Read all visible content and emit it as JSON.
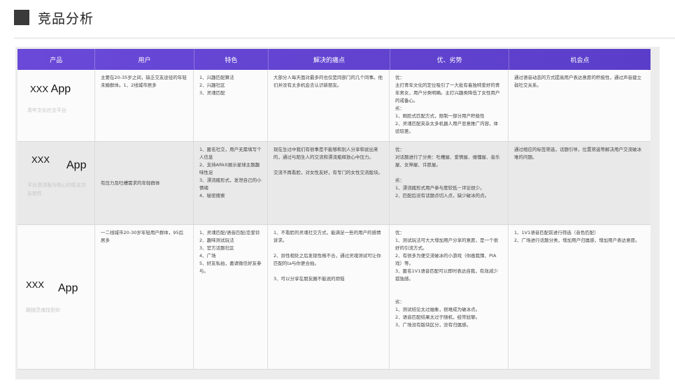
{
  "page": {
    "title": "竞品分析"
  },
  "table": {
    "headers": [
      "产品",
      "用户",
      "特色",
      "解决的痛点",
      "优、劣势",
      "机会点"
    ],
    "rows": [
      {
        "product": {
          "xxx": "XXX",
          "app": "App",
          "tagline": "青年文化社交平台"
        },
        "users": "主要在20-35岁之间，缺乏交友途径的年轻未婚群体。1、2线城市居多",
        "features": "1、兴趣匹配算法\n2、兴趣社区\n3、灵魂匹配",
        "pain_points": "大部分人每天面对最多的也仅是同部门的几个同事。他们并没有太多机会去认识新朋友。",
        "pros_cons": "优：\n主打青年文化的定位吸引了一大批有着独特爱好的青年男女，用户分类明确。主打兴趣类降低了女性用户的戒备心。\n劣：\n1、刷脸式匹配方式，限制一部分用户积极性\n2、灵魂匹配夹杂太多机器人用户恶意推广内容，体验较差。",
        "opportunity": "通过语音动态的方式提高用户表达意愿的积极性，通过声音建立弱社交关系。"
      },
      {
        "product": {
          "xxx": "XXX",
          "app": "App",
          "tagline": "平台漂流瓶为核心的匿名交友软件"
        },
        "users": "有压力及吐槽需求的年轻群体",
        "features": "1、匿名社交，用户无需填写个人信息\n2、支持ARkit展示星球主题趣味性足\n3、漂流瓶形式，发泄自己的小情绪\n4、秘密搜索",
        "pain_points": "现在生过中我们有很事是不能够和别人分享和说出来的，通过与陌生人的交流和漂流瓶释放心中压力。\n\n交流不再看脸，对女性友好，有专门的女性交流版块。",
        "pros_cons": "优：\n对话题进行了分类：吐槽屋、爱情屋、缠懂屋、音乐屋、女神屋、许愿屋。\n\n劣：\n1、漂流瓶形式用户参与度较低－评论很少。\n2、匹配后没有话题点切入点，缺少破冰的点。",
        "opportunity": "通过相应的标签筛选，话题引导，位置筛选等解决用户交流破冰难的问题。"
      },
      {
        "product": {
          "xxx": "XXX",
          "app": "App",
          "tagline": "跟随灵魂找到你"
        },
        "users": "一二线城市20-30岁年轻用户群体，95后居多",
        "features": "1、灵魂匹配/语音匹配/恋爱铃\n2、趣味测试玩法\n3、官方话题社区\n4、广场\n5、好友私拍，邀请微信好友参与。",
        "pain_points": "1、不看脸的灵魂社交方式，能满足一些的用户的感情诉求。\n\n2、异性相处之后发现性格不合，通过灵魂测试可让你匹配的ta与你更合拍。\n\n3、可以分享在朋友圈不能说的烦恼",
        "pros_cons": "优：\n1、测试玩法可大大增加用户分享的意愿，是一个很好的引流方式。\n2、有很多为便交流破冰的小游戏（你画我猜、PIA戏）等。\n3、匿名1V1语音匹配可以即时表达自我，有效减少孤独感。\n\n\n劣：\n1、测试结论太过抽象，很难成为破冰点。\n2、语音匹配结果太过于随机，经常尬聊。\n3、广场没有版块区分，没有归属感。",
        "opportunity": "1、1V1语音匹配前进行筛选（音色匹配）\n2、广场进行话题分类，增加用户归属感，增加用户表达意愿。"
      }
    ]
  },
  "colors": {
    "header_gradient_start": "#6a49d8",
    "header_gradient_end": "#5a3ec9"
  }
}
